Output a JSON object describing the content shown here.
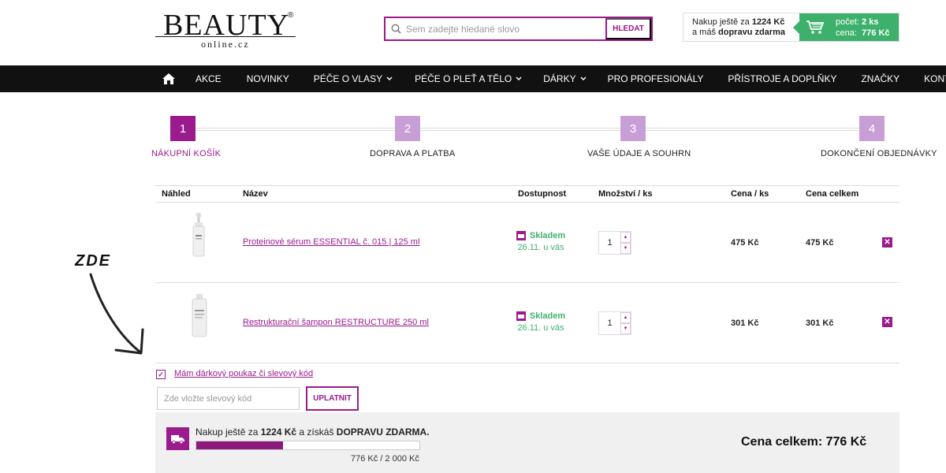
{
  "header": {
    "logo_text": "BEAUTY",
    "logo_reg": "®",
    "logo_sub": "online.cz",
    "search_placeholder": "Sem zadejte hledané slovo",
    "search_button": "HLEDAT",
    "cart_promo_line1_prefix": "Nakup ještě za ",
    "cart_promo_amount": "1224 Kč",
    "cart_promo_line2_prefix": "a máš ",
    "cart_promo_line2_bold": "dopravu zdarma",
    "cart_count_label": "počet:",
    "cart_count_value": "2 ks",
    "cart_price_label": "cena:",
    "cart_price_value": "776 Kč"
  },
  "nav": {
    "items": [
      {
        "label": "AKCE"
      },
      {
        "label": "NOVINKY"
      },
      {
        "label": "PÉČE O VLASY"
      },
      {
        "label": "PÉČE O PLEŤ A TĚLO"
      },
      {
        "label": "DÁRKY"
      },
      {
        "label": "PRO PROFESIONÁLY"
      },
      {
        "label": "PŘÍSTROJE A DOPLŇKY"
      },
      {
        "label": "ZNAČKY"
      },
      {
        "label": "KONTAKT"
      }
    ]
  },
  "steps": [
    {
      "number": "1",
      "label": "NÁKUPNÍ KOŠÍK"
    },
    {
      "number": "2",
      "label": "DOPRAVA A PLATBA"
    },
    {
      "number": "3",
      "label": "VAŠE ÚDAJE A SOUHRN"
    },
    {
      "number": "4",
      "label": "DOKONČENÍ OBJEDNÁVKY"
    }
  ],
  "table": {
    "headers": {
      "preview": "Náhled",
      "name": "Název",
      "availability": "Dostupnost",
      "quantity": "Množství / ks",
      "unit_price": "Cena / ks",
      "total_price": "Cena celkem"
    },
    "rows": [
      {
        "name": "Proteinové sérum ESSENTIAL č. 015 | 125 ml",
        "availability": "Skladem",
        "delivery": "26.11. u vás",
        "quantity": "1",
        "unit_price": "475 Kč",
        "total_price": "475 Kč"
      },
      {
        "name": "Restrukturační šampon RESTRUCTURE 250 ml",
        "availability": "Skladem",
        "delivery": "26.11. u vás",
        "quantity": "1",
        "unit_price": "301 Kč",
        "total_price": "301 Kč"
      }
    ]
  },
  "annotation": {
    "text": "ZDE"
  },
  "voucher": {
    "checkbox_label": "Mám dárkový poukaz či slevový kód",
    "input_placeholder": "Zde vložte slevový kód",
    "apply_button": "UPLATNIT"
  },
  "summary": {
    "free_prefix": "Nakup ještě za ",
    "free_amount": "1224 Kč",
    "free_middle": " a získáš ",
    "free_bold": "DOPRAVU ZDARMA.",
    "progress_fraction": 0.388,
    "progress_text": "776 Kč / 2 000 Kč",
    "total_text": "Cena celkem: 776 Kč"
  },
  "colors": {
    "brand": "#9b1a8c",
    "step_active": "#9b1a8c",
    "step_inactive": "#c79fd6",
    "green": "#3db16b",
    "nav_bg": "#111111"
  }
}
